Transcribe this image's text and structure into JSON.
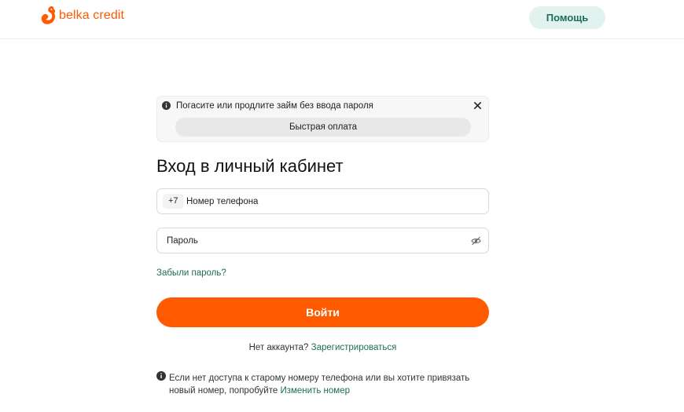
{
  "header": {
    "logo_text": "belka credit",
    "help_label": "Помощь"
  },
  "notice": {
    "text": "Погасите или продлите займ без ввода пароля",
    "fast_pay_label": "Быстрая оплата"
  },
  "login": {
    "title": "Вход в личный кабинет",
    "phone_prefix": "+7",
    "phone_placeholder": "Номер телефона",
    "password_placeholder": "Пароль",
    "forgot_label": "Забыли пароль?",
    "submit_label": "Войти",
    "no_account_text": "Нет аккаунта?",
    "register_label": "Зарегистрироваться"
  },
  "info": {
    "line1": "Если нет доступа к старому номеру телефона или вы хотите привязать",
    "line2_prefix": "новый номер, попробуйте",
    "change_number_label": "Изменить номер"
  },
  "colors": {
    "brand_orange": "#ff5a00",
    "link_green": "#1d6c5a",
    "help_bg": "#e2f2ef"
  },
  "icons": {
    "logo": "squirrel-logo-icon",
    "notice": "info-icon",
    "close": "close-icon",
    "password_toggle": "eye-off-icon",
    "info": "info-icon"
  }
}
